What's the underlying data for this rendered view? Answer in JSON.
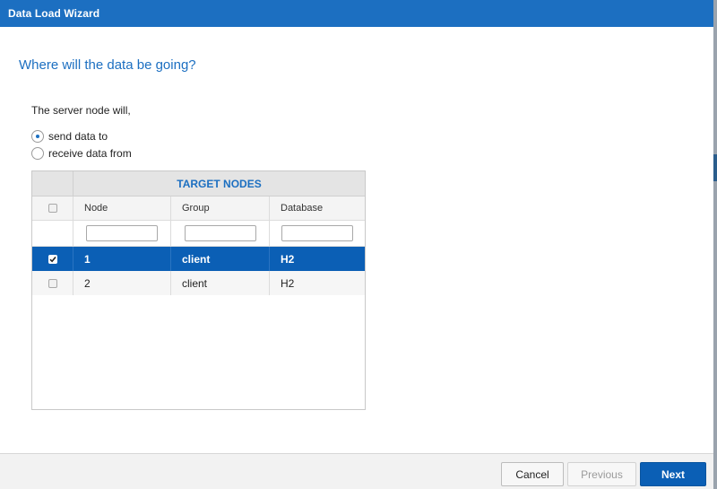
{
  "window": {
    "title": "Data Load Wizard"
  },
  "page": {
    "heading": "Where will the data be going?",
    "intro": "The server node will,"
  },
  "direction": {
    "options": [
      {
        "label": "send data to",
        "checked": true
      },
      {
        "label": "receive data from",
        "checked": false
      }
    ]
  },
  "grid": {
    "group_title": "TARGET NODES",
    "columns": [
      "Node",
      "Group",
      "Database"
    ],
    "filters": [
      "",
      "",
      ""
    ],
    "rows": [
      {
        "checked": true,
        "selected": true,
        "node": "1",
        "group": "client",
        "database": "H2"
      },
      {
        "checked": false,
        "selected": false,
        "node": "2",
        "group": "client",
        "database": "H2"
      }
    ]
  },
  "footer": {
    "cancel_label": "Cancel",
    "previous_label": "Previous",
    "next_label": "Next"
  },
  "colors": {
    "accent": "#1c6fc1",
    "selected_row": "#0b5fb5"
  }
}
